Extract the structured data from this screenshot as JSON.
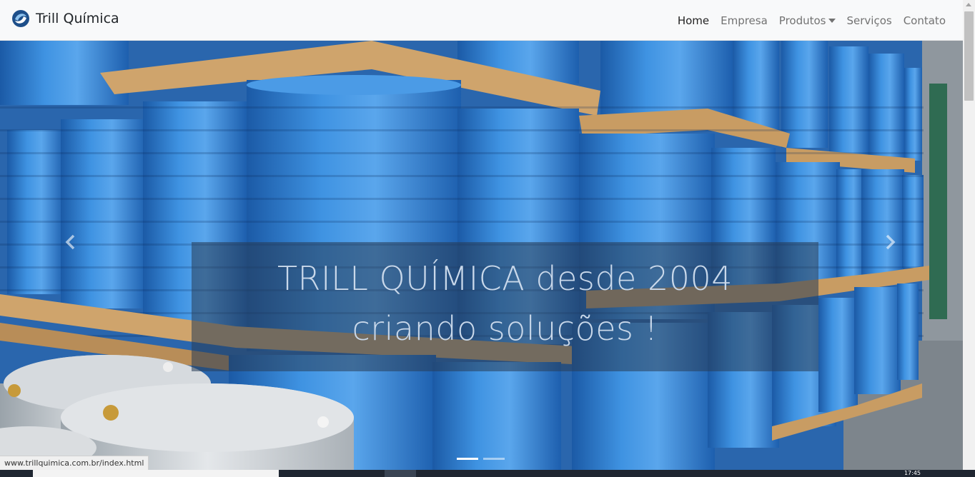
{
  "brand": {
    "name": "Trill Química",
    "logo_icon": "trill-logo-icon"
  },
  "nav": {
    "items": [
      {
        "label": "Home",
        "active": true
      },
      {
        "label": "Empresa",
        "active": false
      },
      {
        "label": "Produtos",
        "active": false,
        "dropdown": true
      },
      {
        "label": "Serviços",
        "active": false
      },
      {
        "label": "Contato",
        "active": false
      }
    ]
  },
  "carousel": {
    "caption_line1": "TRILL QUÍMICA desde 2004",
    "caption_line2": "criando soluções !",
    "prev_icon": "chevron-left-icon",
    "next_icon": "chevron-right-icon",
    "slides": 2,
    "active_slide": 1
  },
  "status_bar": {
    "url": "www.trillquimica.com.br/index.html"
  },
  "taskbar": {
    "clock": "17:45"
  },
  "colors": {
    "drum_blue": "#2f7fd1",
    "pallet": "#caa06a",
    "caption_bg": "#283c55"
  }
}
